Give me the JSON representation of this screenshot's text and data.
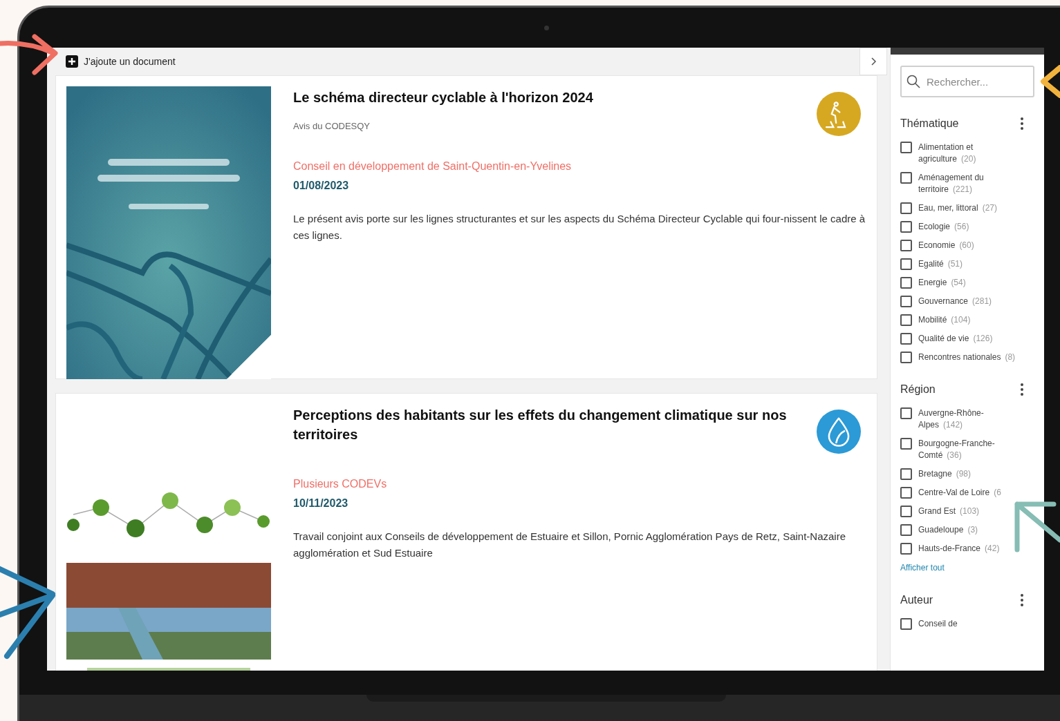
{
  "toolbar": {
    "add_label": "J'ajoute un document"
  },
  "documents": [
    {
      "kind": "cycling",
      "title": "Le schéma directeur cyclable à l'horizon 2024",
      "subtitle": "Avis du CODESQY",
      "author": "Conseil en développement de Saint-Quentin-en-Yvelines",
      "date": "01/08/2023",
      "summary": "Le présent avis porte sur les lignes structurantes et sur les aspects du Schéma Directeur Cyclable qui four-nissent le cadre à ces lignes.",
      "color": "#d6a822"
    },
    {
      "kind": "climate",
      "title": "Perceptions des habitants sur les effets du changement climatique sur nos territoires",
      "author": "Plusieurs CODEVs",
      "date": "10/11/2023",
      "summary": "Travail conjoint aux Conseils de développement de Estuaire et Sillon, Pornic Agglomération Pays de Retz, Saint-Nazaire agglomération et Sud Estuaire",
      "color": "#2b9ad6"
    }
  ],
  "sidebar": {
    "search": {
      "placeholder": "Rechercher..."
    },
    "facets": [
      {
        "title": "Thématique",
        "items": [
          {
            "label": "Alimentation et agriculture",
            "count": "(20)",
            "checked": false
          },
          {
            "label": "Aménagement du territoire",
            "count": "(221)",
            "checked": false
          },
          {
            "label": "Eau, mer, littoral",
            "count": "(27)",
            "checked": false
          },
          {
            "label": "Ecologie",
            "count": "(56)",
            "checked": false
          },
          {
            "label": "Economie",
            "count": "(60)",
            "checked": false
          },
          {
            "label": "Egalité",
            "count": "(51)",
            "checked": false
          },
          {
            "label": "Energie",
            "count": "(54)",
            "checked": false
          },
          {
            "label": "Gouvernance",
            "count": "(281)",
            "checked": false
          },
          {
            "label": "Mobilité",
            "count": "(104)",
            "checked": false
          },
          {
            "label": "Qualité de vie",
            "count": "(126)",
            "checked": false
          },
          {
            "label": "Rencontres nationales",
            "count": "(8)",
            "checked": false
          }
        ]
      },
      {
        "title": "Région",
        "show_all": "Afficher tout",
        "items": [
          {
            "label": "Auvergne-Rhône-Alpes",
            "count": "(142)",
            "checked": false
          },
          {
            "label": "Bourgogne-Franche-Comté",
            "count": "(36)",
            "checked": false
          },
          {
            "label": "Bretagne",
            "count": "(98)",
            "checked": false
          },
          {
            "label": "Centre-Val de Loire",
            "count": "(6",
            "checked": false
          },
          {
            "label": "Grand Est",
            "count": "(103)",
            "checked": false
          },
          {
            "label": "Guadeloupe",
            "count": "(3)",
            "checked": false
          },
          {
            "label": "Hauts-de-France",
            "count": "(42)",
            "checked": false
          }
        ]
      },
      {
        "title": "Auteur",
        "items": [
          {
            "label": "Conseil de",
            "checked": false
          }
        ]
      }
    ]
  }
}
